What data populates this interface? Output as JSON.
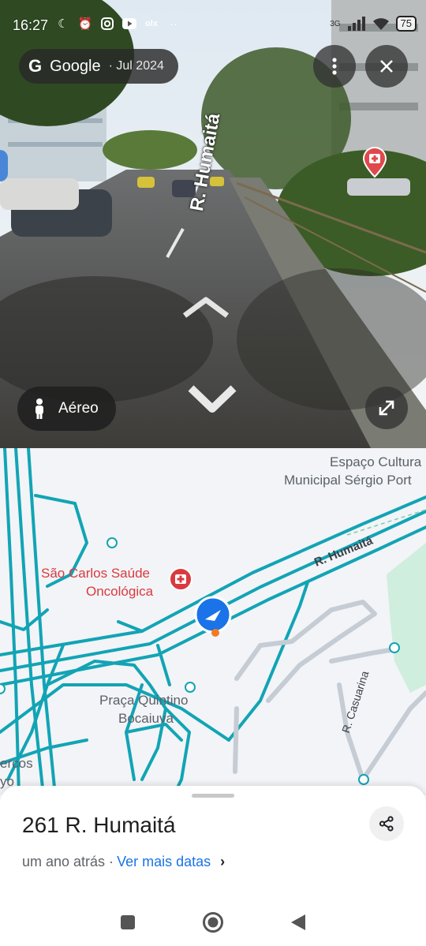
{
  "status_bar": {
    "time": "16:27",
    "battery": "75",
    "left_icons": [
      "moon-icon",
      "alarm-icon",
      "instagram-icon",
      "youtube-icon",
      "olx-icon",
      "more-dots-icon"
    ],
    "right_icons": [
      "signal-3g-icon",
      "signal-icon",
      "wifi-icon",
      "battery-icon"
    ],
    "network": "3G"
  },
  "street_view": {
    "brand": "Google",
    "capture_date": "Jul 2024",
    "street_label": "R. Humaitá",
    "aerial_button": "Aéreo"
  },
  "map": {
    "street_main": "R. Humaitá",
    "street_secondary": "R. Casuarina",
    "pois": {
      "hospital_line1": "São Carlos Saúde",
      "hospital_line2": "Oncológica",
      "square_line1": "Praça Quintino",
      "square_line2": "Bocaiuva",
      "culture_line1": "Espaço Cultura",
      "culture_line2": "Municipal Sérgio Port",
      "partial_line1": "ercos",
      "partial_line2": "yo"
    },
    "colors": {
      "road": "#12a4b5",
      "background": "#f2f4f7",
      "poi_red": "#d93a3f",
      "location_blue": "#1a73e8"
    }
  },
  "sheet": {
    "address": "261 R. Humaitá",
    "time_ago": "um ano atrás ·",
    "more_dates_link": "Ver mais datas",
    "chevron": "›"
  },
  "nav": {
    "icons": [
      "recents-square-icon",
      "home-circle-icon",
      "back-triangle-icon"
    ]
  }
}
